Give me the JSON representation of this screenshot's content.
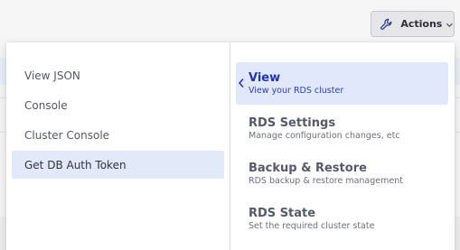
{
  "actions_button": {
    "label": "Actions",
    "icon": "wrench-icon",
    "caret_icon": "chevron-down-icon"
  },
  "left_menu": {
    "items": [
      {
        "label": "View JSON",
        "selected": false
      },
      {
        "label": "Console",
        "selected": false
      },
      {
        "label": "Cluster Console",
        "selected": false
      },
      {
        "label": "Get DB Auth Token",
        "selected": true
      }
    ]
  },
  "right_menu": {
    "back_icon": "chevron-left-icon",
    "items": [
      {
        "title": "View",
        "subtitle": "View your RDS cluster",
        "active": true
      },
      {
        "title": "RDS Settings",
        "subtitle": "Manage configuration changes, etc",
        "active": false
      },
      {
        "title": "Backup & Restore",
        "subtitle": "RDS backup & restore management",
        "active": false
      },
      {
        "title": "RDS State",
        "subtitle": "Set the required cluster state",
        "active": false
      }
    ]
  },
  "colors": {
    "accent": "#1f33b6",
    "active_bg": "#e2e8fb",
    "selected_bg": "#e2e9f9",
    "button_bg": "#e6e6e8"
  }
}
